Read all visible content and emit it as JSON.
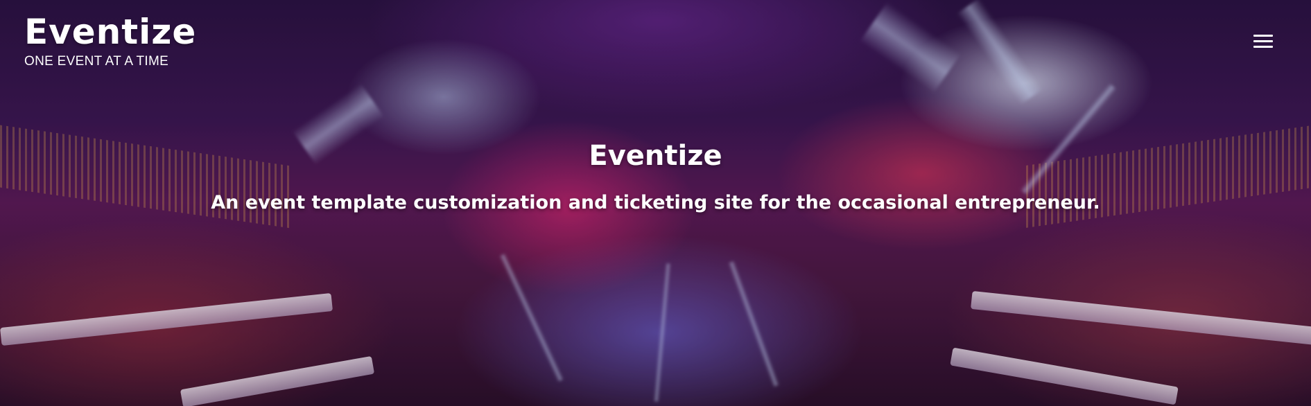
{
  "header": {
    "brand_title": "Eventize",
    "brand_tagline": "ONE EVENT AT A TIME",
    "menu_icon": "hamburger-menu-icon"
  },
  "hero": {
    "title": "Eventize",
    "subtitle": "An event template customization and ticketing site for the occasional entrepreneur.",
    "background": "concert-hall-light-show-photo"
  },
  "colors": {
    "text": "#ffffff",
    "background_dark": "#2a1240",
    "accent_magenta": "#c0307a",
    "accent_blue": "#6a7cff"
  }
}
